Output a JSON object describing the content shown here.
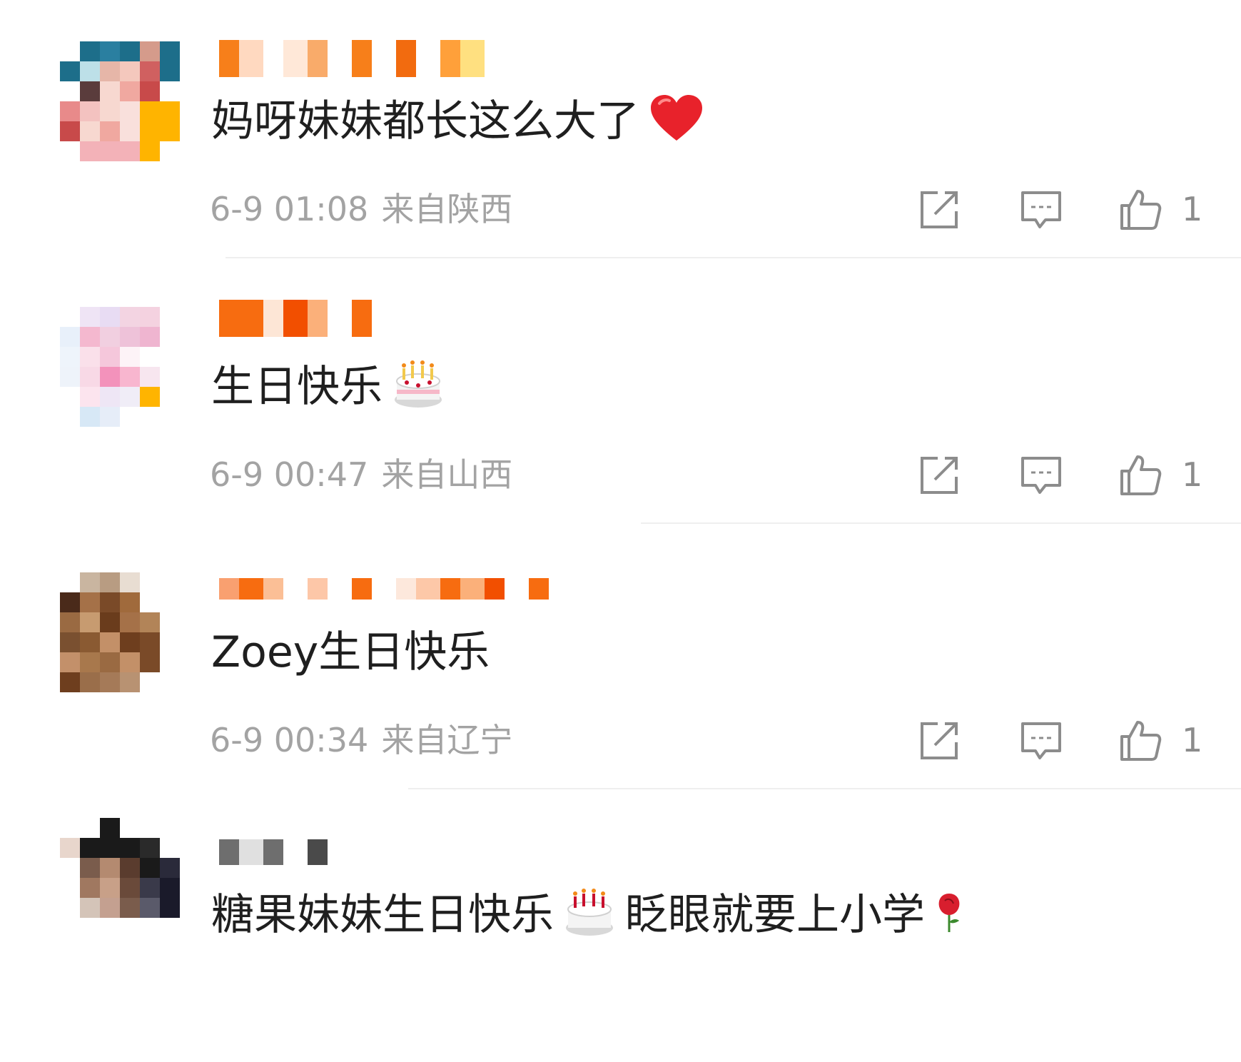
{
  "comments": [
    {
      "text": "妈呀妹妹都长这么大了",
      "emoji": "heart-emoji",
      "time": "6-9 01:08",
      "location": "来自陕西",
      "likes": "1",
      "avatar_colors": [
        "#ffffff",
        "#1d6e8a",
        "#2a7fa0",
        "#1d6e8a",
        "#d59b8b",
        "#1d6e8a",
        "#1d6e8a",
        "#bde0e8",
        "#e6b6a8",
        "#f4c8bd",
        "#d06060",
        "#1d6e8a",
        "#ffffff",
        "#5a3c3c",
        "#f7d8d0",
        "#f0a8a0",
        "#c84a4a",
        "#ffffff",
        "#e88a8a",
        "#f3c2c0",
        "#f7d8d0",
        "#f9e0dc",
        "#ffb400",
        "#ffb400",
        "#c84a4a",
        "#f7d8d0",
        "#f0a8a0",
        "#f9e0dc",
        "#ffb400",
        "#ffb400",
        "#ffffff",
        "#f3b2b8",
        "#f3b2b8",
        "#f3b2b8",
        "#ffb400",
        "#ffffff"
      ],
      "nickname_colors": [
        "#f77f1a",
        "#ffd9c0",
        "#ffffff",
        "#ffe8d8",
        "#f9ab6a",
        "#ffffff",
        "#f77f1a",
        "#ffffff",
        "#f26b0f",
        "#ffffff",
        "#ffa03a",
        "#ffe080"
      ]
    },
    {
      "text": "生日快乐",
      "emoji": "birthday-cake-emoji",
      "time": "6-9 00:47",
      "location": "来自山西",
      "likes": "1",
      "avatar_colors": [
        "#ffffff",
        "#efe4f5",
        "#e8dcf3",
        "#f3d4e2",
        "#f4d2e0",
        "#ffffff",
        "#e8f0fa",
        "#f4b8cf",
        "#f1cfe0",
        "#eec2d9",
        "#efb5d0",
        "#ffffff",
        "#eef4fb",
        "#fae0ea",
        "#f5c7db",
        "#fdf3f7",
        "#ffffff",
        "#ffffff",
        "#eef3fa",
        "#f8d9e6",
        "#f392bb",
        "#f8b6cf",
        "#f7e6ef",
        "#ffffff",
        "#ffffff",
        "#fce4ee",
        "#eee6f5",
        "#f0edf7",
        "#ffb400",
        "#ffffff",
        "#ffffff",
        "#d7e8f6",
        "#e6edf8",
        "#ffffff",
        "#ffffff",
        "#ffffff"
      ],
      "nickname_colors": [
        "#f76c10",
        "#f76c10",
        "#fde6d6",
        "#f24f00",
        "#fbb07a",
        "#ffffff",
        "#f76c10"
      ]
    },
    {
      "text": "Zoey生日快乐",
      "emoji": "",
      "time": "6-9 00:34",
      "location": "来自辽宁",
      "likes": "1",
      "avatar_colors": [
        "#ffffff",
        "#c9b5a0",
        "#b89c82",
        "#e8ddd2",
        "#ffffff",
        "#ffffff",
        "#4a2a1a",
        "#a57148",
        "#7a4a28",
        "#a06a3c",
        "#ffffff",
        "#ffffff",
        "#9a6a42",
        "#c79b70",
        "#6a3c1c",
        "#a57148",
        "#b28458",
        "#ffffff",
        "#7a5030",
        "#8a5a32",
        "#c39068",
        "#6e3e1e",
        "#7a4a28",
        "#ffffff",
        "#c3906a",
        "#a8784c",
        "#9a6a42",
        "#c39068",
        "#7a4a28",
        "#ffffff",
        "#6e3e1e",
        "#9a6e4a",
        "#a57a58",
        "#b89272",
        "#ffffff",
        "#ffffff"
      ],
      "nickname_colors": [
        "#f9a070",
        "#f76c10",
        "#fbbf96",
        "#ffffff",
        "#fdc7a8",
        "#ffffff",
        "#f76c10",
        "#ffffff",
        "#fde8dc",
        "#fdc8a8",
        "#f76c10",
        "#fbb07a",
        "#f24f00",
        "#ffffff",
        "#f76c10"
      ]
    },
    {
      "text": "糖果妹妹生日快乐",
      "emoji": "",
      "text2": "眨眼就要上小学",
      "avatar_colors": [
        "#ffffff",
        "#ffffff",
        "#1a1a1a",
        "#ffffff",
        "#ffffff",
        "#ffffff",
        "#e8d6cc",
        "#1a1a1a",
        "#1a1a1a",
        "#1a1a1a",
        "#2a2a2a",
        "#ffffff",
        "#ffffff",
        "#7a5c4c",
        "#b48a70",
        "#5a3c2e",
        "#1a1a1a",
        "#2a2a3a",
        "#ffffff",
        "#a07860",
        "#c8a088",
        "#6a4a3a",
        "#3a3a4a",
        "#1a1a2a",
        "#ffffff",
        "#d4c4b8",
        "#c4a090",
        "#7a5c4c",
        "#5a5a6a",
        "#1a1a2a",
        "#ffffff",
        "#ffffff",
        "#ffffff",
        "#ffffff",
        "#ffffff",
        "#ffffff"
      ],
      "nickname_colors": [
        "#6e6e6e",
        "#e0e0e0",
        "#6e6e6e",
        "#ffffff",
        "#4a4a4a"
      ]
    }
  ]
}
